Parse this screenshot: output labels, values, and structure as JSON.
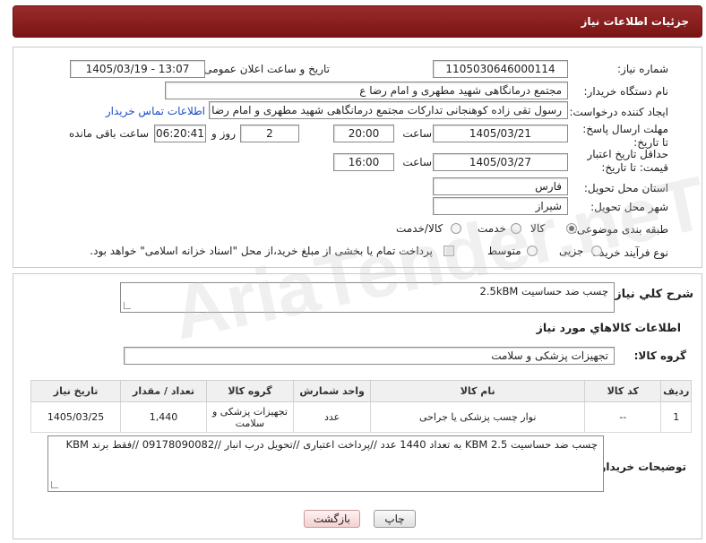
{
  "header": {
    "title": "جزئیات اطلاعات نیاز"
  },
  "fields": {
    "need_number_label": "شماره نیاز:",
    "need_number": "1105030646000114",
    "announce_label": "تاریخ و ساعت اعلان عمومی:",
    "announce_value": "1405/03/19 - 13:07",
    "buyer_org_label": "نام دستگاه خریدار:",
    "buyer_org": "مجتمع درمانگاهی شهید مطهری و امام رضا  ع",
    "creator_label": "ایجاد کننده درخواست:",
    "creator": "رسول تقی زاده کوهنجانی تدارکات مجتمع درمانگاهی شهید مطهری و امام رضا",
    "contact_link": "اطلاعات تماس خریدار",
    "reply_deadline_label": "مهلت ارسال پاسخ: تا تاریخ:",
    "reply_date": "1405/03/21",
    "time_label": "ساعت",
    "reply_time": "20:00",
    "days_value": "2",
    "days_label": "روز و",
    "remaining_time": "06:20:41",
    "remaining_label": "ساعت باقی مانده",
    "price_validity_label": "حداقل تاریخ اعتبار قیمت: تا تاریخ:",
    "price_date": "1405/03/27",
    "price_time": "16:00",
    "province_label": "استان محل تحویل:",
    "province": "فارس",
    "city_label": "شهر محل تحویل:",
    "city": "شیراز",
    "category_label": "طبقه بندی موضوعی:",
    "category_options": [
      "کالا",
      "خدمت",
      "کالا/خدمت"
    ],
    "process_label": "نوع فرآیند خرید :",
    "process_options": [
      "جزیی",
      "متوسط"
    ],
    "payment_note": "پرداخت تمام یا بخشی از مبلغ خرید،از محل \"اسناد خزانه اسلامی\" خواهد بود."
  },
  "description": {
    "label": "شرح کلي نياز:",
    "value": "چسب ضد حساسیت 2.5kBM"
  },
  "goods": {
    "section_title": "اطلاعات کالاهاي مورد نياز",
    "group_label": "گروه کالا:",
    "group_value": "تجهیزات پزشکی و سلامت"
  },
  "table": {
    "headers": [
      "ردیف",
      "کد کالا",
      "نام کالا",
      "واحد شمارش",
      "گروه کالا",
      "تعداد / مقدار",
      "تاریخ نیاز"
    ],
    "rows": [
      [
        "1",
        "--",
        "نوار چسب پزشکی یا جراحی",
        "عدد",
        "تجهیزات پزشکی و سلامت",
        "1,440",
        "1405/03/25"
      ]
    ]
  },
  "buyer_notes": {
    "label": "توضیحات خریدار:",
    "value": "چسب ضد حساسیت KBM 2.5 به تعداد 1440 عدد //پرداخت اعتباری //تحویل درب انبار //09178090082 //فقط برند KBM"
  },
  "buttons": {
    "print": "چاپ",
    "back": "بازگشت"
  },
  "watermark": "AriaTender.neT"
}
